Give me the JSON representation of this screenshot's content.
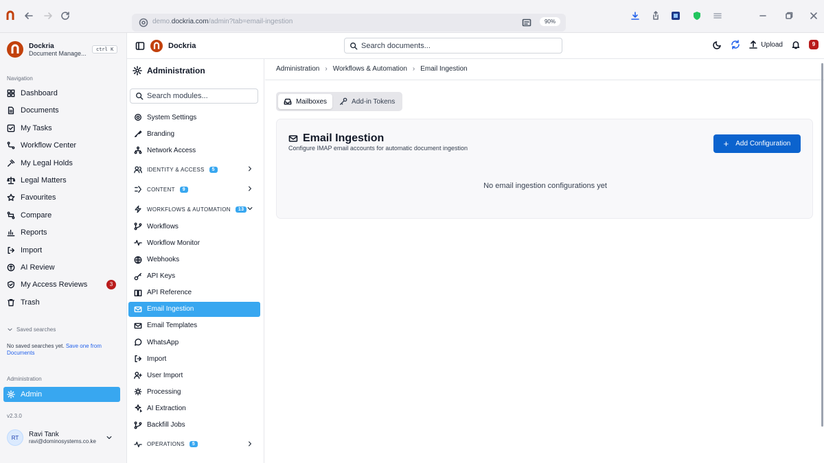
{
  "browser": {
    "url_prefix": "demo.",
    "url_domain": "dockria.com",
    "url_path": "/admin?tab=email-ingestion",
    "zoom": "90%"
  },
  "app": {
    "name": "Dockria",
    "subtitle": "Document Manage...",
    "shortcut": "ctrl K",
    "version": "v2.3.0"
  },
  "topbar": {
    "search_placeholder": "Search documents...",
    "upload_label": "Upload",
    "notification_count": "9"
  },
  "sidebar": {
    "nav_heading": "Navigation",
    "items": [
      {
        "label": "Dashboard",
        "icon": "grid-icon"
      },
      {
        "label": "Documents",
        "icon": "file-icon"
      },
      {
        "label": "My Tasks",
        "icon": "check-square-icon"
      },
      {
        "label": "Workflow Center",
        "icon": "workflow-icon"
      },
      {
        "label": "My Legal Holds",
        "icon": "gavel-icon"
      },
      {
        "label": "Legal Matters",
        "icon": "scale-icon"
      },
      {
        "label": "Favourites",
        "icon": "star-icon"
      },
      {
        "label": "Compare",
        "icon": "compare-icon"
      },
      {
        "label": "Reports",
        "icon": "bar-chart-icon"
      },
      {
        "label": "Import",
        "icon": "import-icon"
      },
      {
        "label": "AI Review",
        "icon": "ai-icon"
      },
      {
        "label": "My Access Reviews",
        "icon": "shield-check-icon",
        "badge": "3"
      },
      {
        "label": "Trash",
        "icon": "trash-icon"
      }
    ],
    "saved_heading": "Saved searches",
    "saved_note": "No saved searches yet. ",
    "saved_link": "Save one from Documents",
    "admin_heading": "Administration",
    "admin_item": "Admin",
    "user": {
      "initials": "RT",
      "name": "Ravi Tank",
      "email": "ravi@dominosystems.co.ke"
    }
  },
  "modules": {
    "title": "Administration",
    "search_placeholder": "Search modules...",
    "top_items": [
      "System Settings",
      "Branding",
      "Network Access"
    ],
    "groups": {
      "identity": {
        "label": "IDENTITY & ACCESS",
        "count": "5"
      },
      "content": {
        "label": "CONTENT",
        "count": "9"
      },
      "workflows": {
        "label": "WORKFLOWS & AUTOMATION",
        "count": "13"
      },
      "operations": {
        "label": "OPERATIONS",
        "count": "5"
      }
    },
    "workflow_items": [
      "Workflows",
      "Workflow Monitor",
      "Webhooks",
      "API Keys",
      "API Reference",
      "Email Ingestion",
      "Email Templates",
      "WhatsApp",
      "Import",
      "User Import",
      "Processing",
      "AI Extraction",
      "Backfill Jobs"
    ],
    "active_item": "Email Ingestion"
  },
  "main": {
    "breadcrumb": [
      "Administration",
      "Workflows & Automation",
      "Email Ingestion"
    ],
    "tabs": [
      "Mailboxes",
      "Add-in Tokens"
    ],
    "title": "Email Ingestion",
    "subtitle": "Configure IMAP email accounts for automatic document ingestion",
    "add_button": "Add Configuration",
    "empty_message": "No email ingestion configurations yet"
  },
  "colors": {
    "accent": "#38a7f0",
    "primary_button": "#0b63ce",
    "badge": "#b91c1c",
    "brand": "#c2410c"
  }
}
